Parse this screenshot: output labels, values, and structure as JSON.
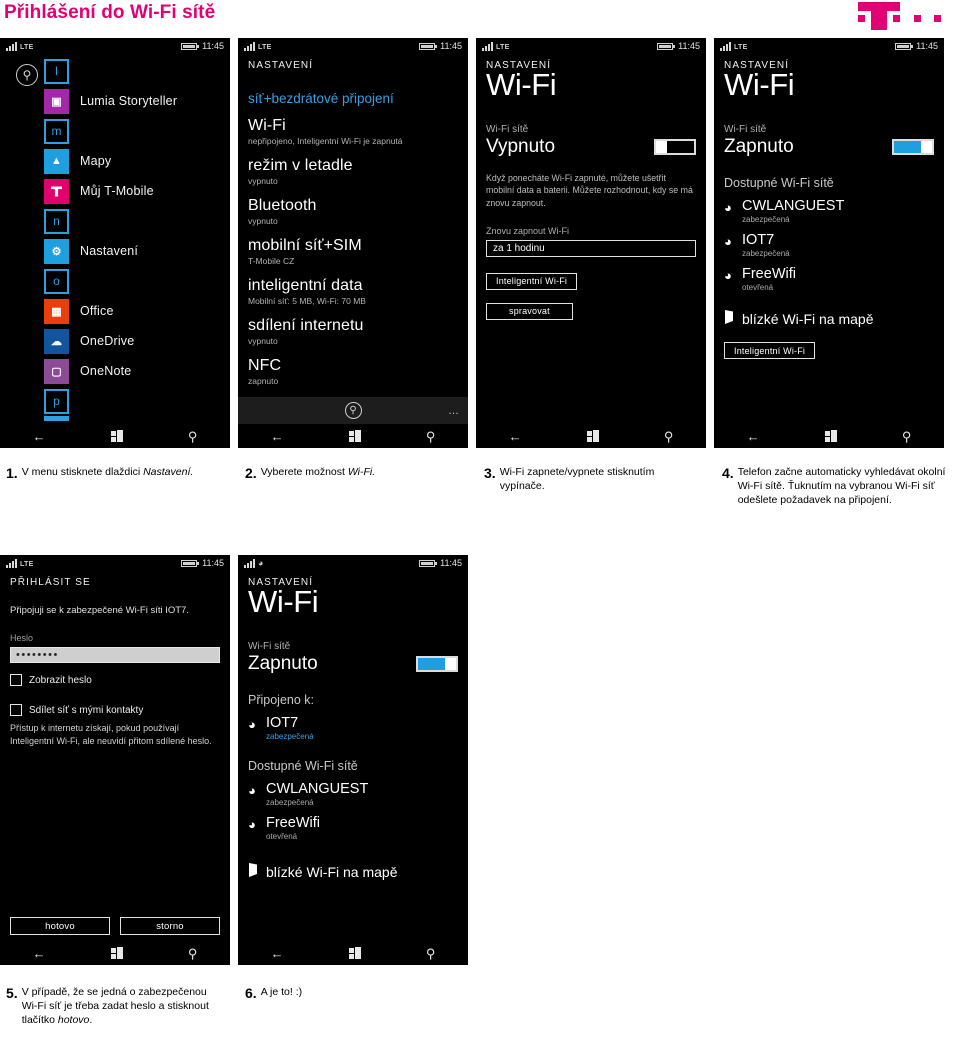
{
  "header": {
    "title": "Přihlášení do Wi-Fi sítě",
    "brand_color": "#e20074",
    "logo_name": "t-mobile-logo"
  },
  "status_bar": {
    "network": "LTE",
    "time": "11:45"
  },
  "nav_bar": {
    "back": "back-icon",
    "start": "windows-icon",
    "search": "search-icon"
  },
  "screens": {
    "app_list": {
      "tiles": [
        {
          "kind": "letter",
          "letter": "l",
          "label": ""
        },
        {
          "kind": "app",
          "letter": "",
          "label": "Lumia Storyteller",
          "color": "#a228a8"
        },
        {
          "kind": "letter",
          "letter": "m",
          "label": ""
        },
        {
          "kind": "app",
          "letter": "",
          "label": "Mapy",
          "color": "#1e9fe0"
        },
        {
          "kind": "app",
          "letter": "",
          "label": "Můj T-Mobile",
          "color": "#e2006a"
        },
        {
          "kind": "letter",
          "letter": "n",
          "label": ""
        },
        {
          "kind": "app",
          "letter": "",
          "label": "Nastavení",
          "color": "#1e9fe0"
        },
        {
          "kind": "letter",
          "letter": "o",
          "label": ""
        },
        {
          "kind": "app",
          "letter": "",
          "label": "Office",
          "color": "#e8400d"
        },
        {
          "kind": "app",
          "letter": "",
          "label": "OneDrive",
          "color": "#12549e"
        },
        {
          "kind": "app",
          "letter": "",
          "label": "OneNote",
          "color": "#8c4b96"
        },
        {
          "kind": "letter",
          "letter": "p",
          "label": ""
        }
      ]
    },
    "settings": {
      "header": "NASTAVENÍ",
      "pivot": "síť+bezdrátové připojení",
      "items": [
        {
          "title": "Wi-Fi",
          "sub": "nepřipojeno, Inteligentní Wi-Fi je zapnutá"
        },
        {
          "title": "režim v letadle",
          "sub": "vypnuto"
        },
        {
          "title": "Bluetooth",
          "sub": "vypnuto"
        },
        {
          "title": "mobilní síť+SIM",
          "sub": "T-Mobile CZ"
        },
        {
          "title": "inteligentní data",
          "sub": "Mobilní síť: 5 MB, Wi-Fi: 70 MB"
        },
        {
          "title": "sdílení internetu",
          "sub": "vypnuto"
        },
        {
          "title": "NFC",
          "sub": "zapnuto"
        }
      ],
      "appbar_more": "…"
    },
    "wifi_off": {
      "header": "NASTAVENÍ",
      "title": "Wi-Fi",
      "section_label": "Wi-Fi sítě",
      "state": "Vypnuto",
      "toggle_state": "off",
      "description": "Když ponecháte Wi-Fi zapnuté, můžete ušetřit mobilní data a baterii. Můžete rozhodnout, kdy se má znovu zapnout.",
      "field_label": "Znovu zapnout Wi-Fi",
      "field_value": "za 1 hodinu",
      "button_smart": "Inteligentní Wi-Fi",
      "button_manage": "spravovat"
    },
    "wifi_on": {
      "header": "NASTAVENÍ",
      "title": "Wi-Fi",
      "section_label": "Wi-Fi sítě",
      "state": "Zapnuto",
      "toggle_state": "on",
      "networks_header": "Dostupné Wi-Fi sítě",
      "networks": [
        {
          "name": "CWLANGUEST",
          "sub": "zabezpečená"
        },
        {
          "name": "IOT7",
          "sub": "zabezpečená"
        },
        {
          "name": "FreeWifi",
          "sub": "otevřená"
        }
      ],
      "map_link": "blízké Wi-Fi na mapě",
      "button_smart": "Inteligentní Wi-Fi"
    },
    "login": {
      "header": "PŘIHLÁSIT SE",
      "intro": "Připojuji se k zabezpečené Wi-Fi síti IOT7.",
      "password_label": "Heslo",
      "password_value": "••••••••",
      "show_password": "Zobrazit heslo",
      "share_network": "Sdílet síť s mými kontakty",
      "share_note": "Přístup k internetu získají, pokud používají Inteligentní Wi-Fi, ale neuvidí přitom sdílené heslo.",
      "button_done": "hotovo",
      "button_cancel": "storno"
    },
    "connected": {
      "header": "NASTAVENÍ",
      "title": "Wi-Fi",
      "section_label": "Wi-Fi sítě",
      "state": "Zapnuto",
      "toggle_state": "on",
      "connected_header": "Připojeno k:",
      "connected_network": {
        "name": "IOT7",
        "sub": "zabezpečená"
      },
      "networks_header": "Dostupné Wi-Fi sítě",
      "networks": [
        {
          "name": "CWLANGUEST",
          "sub": "zabezpečená"
        },
        {
          "name": "FreeWifi",
          "sub": "otevřená"
        }
      ],
      "map_link": "blízké Wi-Fi na mapě"
    }
  },
  "captions": [
    {
      "num": "1.",
      "text": "V menu stisknete dlaždici ",
      "italic": "Nastavení.",
      "tail": ""
    },
    {
      "num": "2.",
      "text": "Vyberete možnost ",
      "italic": "Wi-Fi.",
      "tail": ""
    },
    {
      "num": "3.",
      "text": "Wi-Fi zapnete/vypnete stisknutím vypínače.",
      "italic": "",
      "tail": ""
    },
    {
      "num": "4.",
      "text": "Telefon začne automaticky vyhledávat okolní Wi-Fi sítě. Ťuknutím na vybranou Wi-Fi síť odešlete požadavek na připojení.",
      "italic": "",
      "tail": ""
    },
    {
      "num": "5.",
      "text": "V případě, že se jedná o zabezpečenou Wi-Fi síť je třeba zadat heslo a stisknout tlačítko ",
      "italic": "hotovo",
      "tail": "."
    },
    {
      "num": "6.",
      "text": "A je to! :)",
      "italic": "",
      "tail": ""
    }
  ]
}
